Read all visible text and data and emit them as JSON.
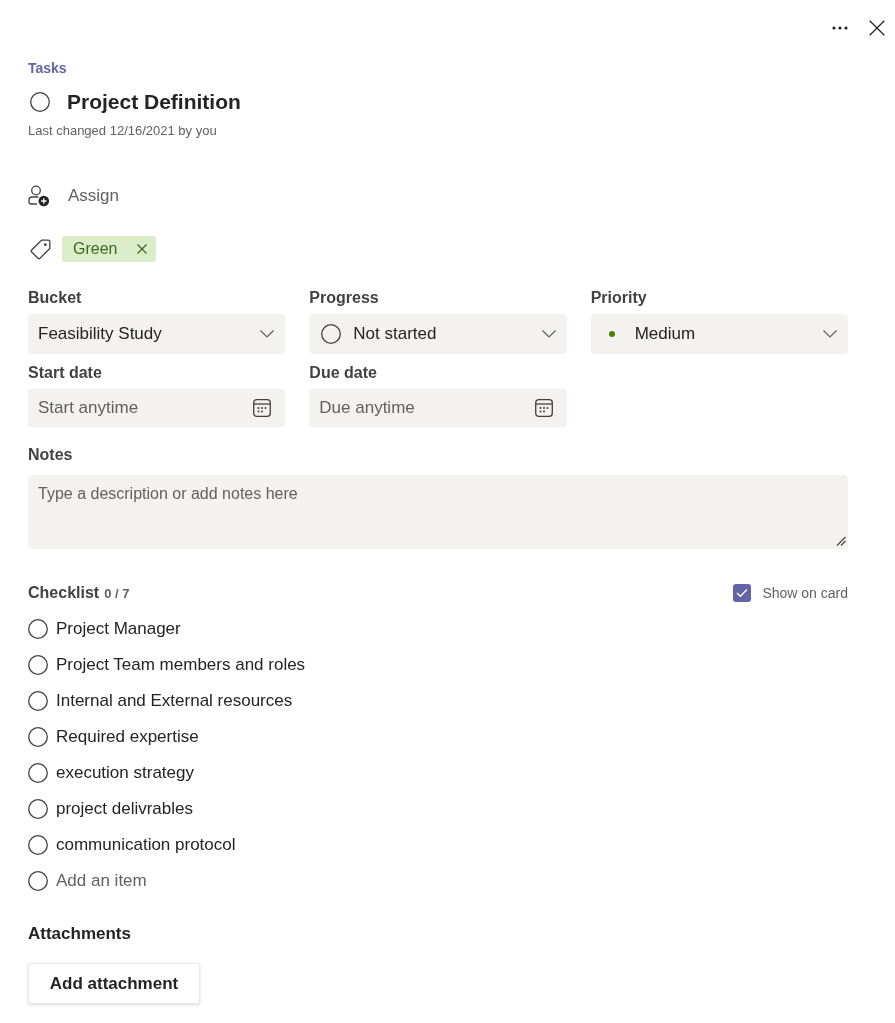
{
  "breadcrumb": "Tasks",
  "task": {
    "title": "Project Definition",
    "completed": false,
    "last_changed": "Last changed 12/16/2021 by you"
  },
  "assign": {
    "label": "Assign"
  },
  "labels": [
    {
      "text": "Green",
      "color": "#dbecc8"
    }
  ],
  "fields": [
    {
      "label": "Bucket",
      "kind": "dropdown",
      "value": "Feasibility Study"
    },
    {
      "label": "Progress",
      "kind": "progress",
      "value": "Not started"
    },
    {
      "label": "Priority",
      "kind": "priority",
      "value": "Medium",
      "color": "#498205"
    },
    {
      "label": "Start date",
      "kind": "date",
      "placeholder": "Start anytime"
    },
    {
      "label": "Due date",
      "kind": "date",
      "placeholder": "Due anytime"
    }
  ],
  "notes": {
    "label": "Notes",
    "placeholder": "Type a description or add notes here"
  },
  "checklist": {
    "title": "Checklist",
    "count": "0 / 7",
    "show_on_card": {
      "label": "Show on card",
      "checked": true
    },
    "items": [
      {
        "text": "Project Manager",
        "checked": false
      },
      {
        "text": "Project Team members and roles",
        "checked": false
      },
      {
        "text": "Internal and External resources",
        "checked": false
      },
      {
        "text": "Required expertise",
        "checked": false
      },
      {
        "text": "execution strategy",
        "checked": false
      },
      {
        "text": "project delivrables",
        "checked": false
      },
      {
        "text": "communication protocol",
        "checked": false
      }
    ],
    "add_item": {
      "placeholder": "Add an item"
    }
  },
  "attachments": {
    "title": "Attachments",
    "button": "Add attachment"
  }
}
